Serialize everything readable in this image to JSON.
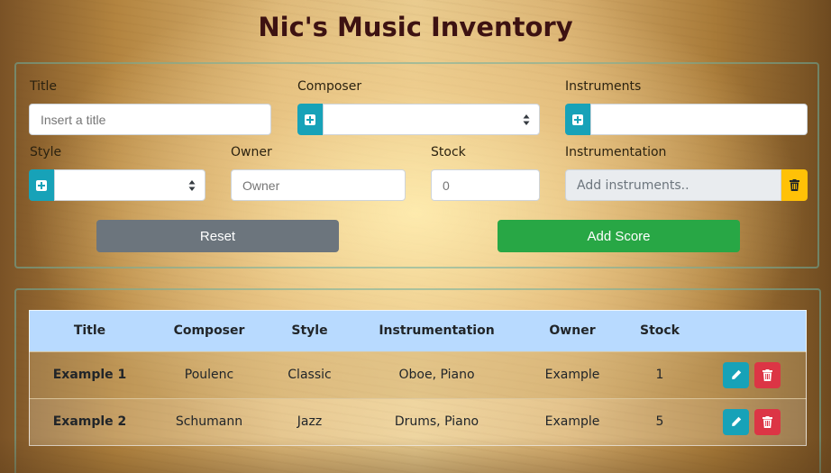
{
  "page": {
    "title": "Nic's Music Inventory"
  },
  "form": {
    "title_label": "Title",
    "title_placeholder": "Insert a title",
    "composer_label": "Composer",
    "instruments_label": "Instruments",
    "style_label": "Style",
    "owner_label": "Owner",
    "owner_placeholder": "Owner",
    "stock_label": "Stock",
    "stock_placeholder": "0",
    "instrumentation_label": "Instrumentation",
    "instrumentation_placeholder": "Add instruments..",
    "reset_label": "Reset",
    "add_label": "Add Score"
  },
  "table": {
    "headers": [
      "Title",
      "Composer",
      "Style",
      "Instrumentation",
      "Owner",
      "Stock"
    ],
    "rows": [
      {
        "title": "Example 1",
        "composer": "Poulenc",
        "style": "Classic",
        "instrumentation": "Oboe, Piano",
        "owner": "Example",
        "stock": "1"
      },
      {
        "title": "Example 2",
        "composer": "Schumann",
        "style": "Jazz",
        "instrumentation": "Drums, Piano",
        "owner": "Example",
        "stock": "5"
      }
    ]
  },
  "colors": {
    "title": "#3d1212",
    "info": "#17a2b8",
    "warning": "#ffc107",
    "secondary": "#6c757d",
    "success": "#28a745",
    "danger": "#dc3545",
    "table_header": "#b8daff"
  },
  "icons": {
    "add": "plus-square-icon",
    "select": "select-arrows-icon",
    "clear": "trash-icon",
    "edit": "pencil-icon",
    "delete": "trash-icon"
  }
}
